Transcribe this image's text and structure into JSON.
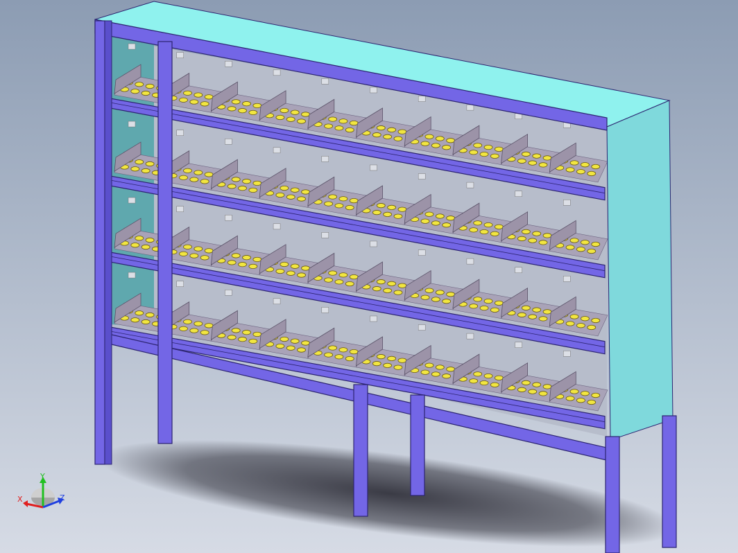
{
  "viewport": {
    "background_top": "#8c9cb3",
    "background_bottom": "#d6dbe5"
  },
  "model": {
    "frame_color": "#7366e6",
    "frame_edge": "#2c2470",
    "panel_color": "#7fd9dc",
    "panel_top_color": "#8ff2ee",
    "shelf_back_color": "#b7bdcb",
    "divider_color": "#9c93a8",
    "roller_color": "#f2e640",
    "roller_dark": "#6a5a10",
    "shadow_color": "#2a2a34",
    "levels": 4,
    "lanes_per_level": 10
  },
  "triad": {
    "x_label": "X",
    "y_label": "Y",
    "z_label": "Z",
    "x_color": "#e02020",
    "y_color": "#20c020",
    "z_color": "#2040e0"
  }
}
